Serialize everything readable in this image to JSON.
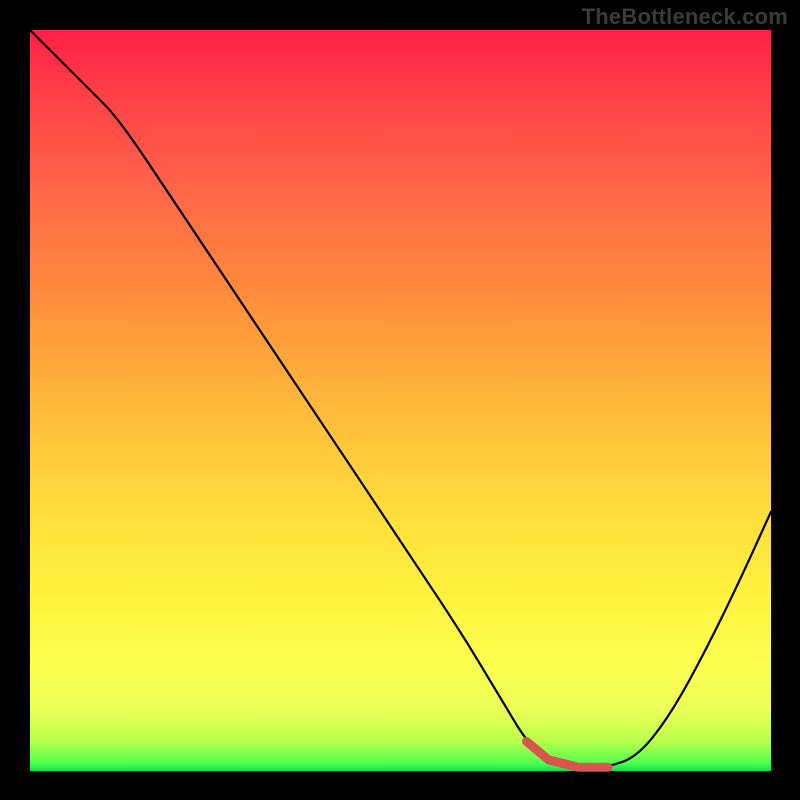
{
  "watermark": "TheBottleneck.com",
  "colors": {
    "background": "#000000",
    "gradient_top": "#ff1f47",
    "gradient_bottom": "#00e558",
    "curve": "#000000",
    "bottom_segment": "#d9544d"
  },
  "chart_data": {
    "type": "line",
    "title": "",
    "xlabel": "",
    "ylabel": "",
    "xlim": [
      0,
      1
    ],
    "ylim": [
      0,
      1
    ],
    "x": [
      0.0,
      0.04,
      0.08,
      0.12,
      0.2,
      0.3,
      0.4,
      0.5,
      0.58,
      0.64,
      0.67,
      0.7,
      0.74,
      0.78,
      0.82,
      0.86,
      0.9,
      0.95,
      1.0
    ],
    "values": [
      1.0,
      0.96,
      0.92,
      0.88,
      0.76,
      0.61,
      0.46,
      0.31,
      0.19,
      0.09,
      0.04,
      0.015,
      0.005,
      0.005,
      0.02,
      0.07,
      0.14,
      0.24,
      0.35
    ],
    "highlight_segment": {
      "x_start": 0.66,
      "x_end": 0.8
    }
  }
}
